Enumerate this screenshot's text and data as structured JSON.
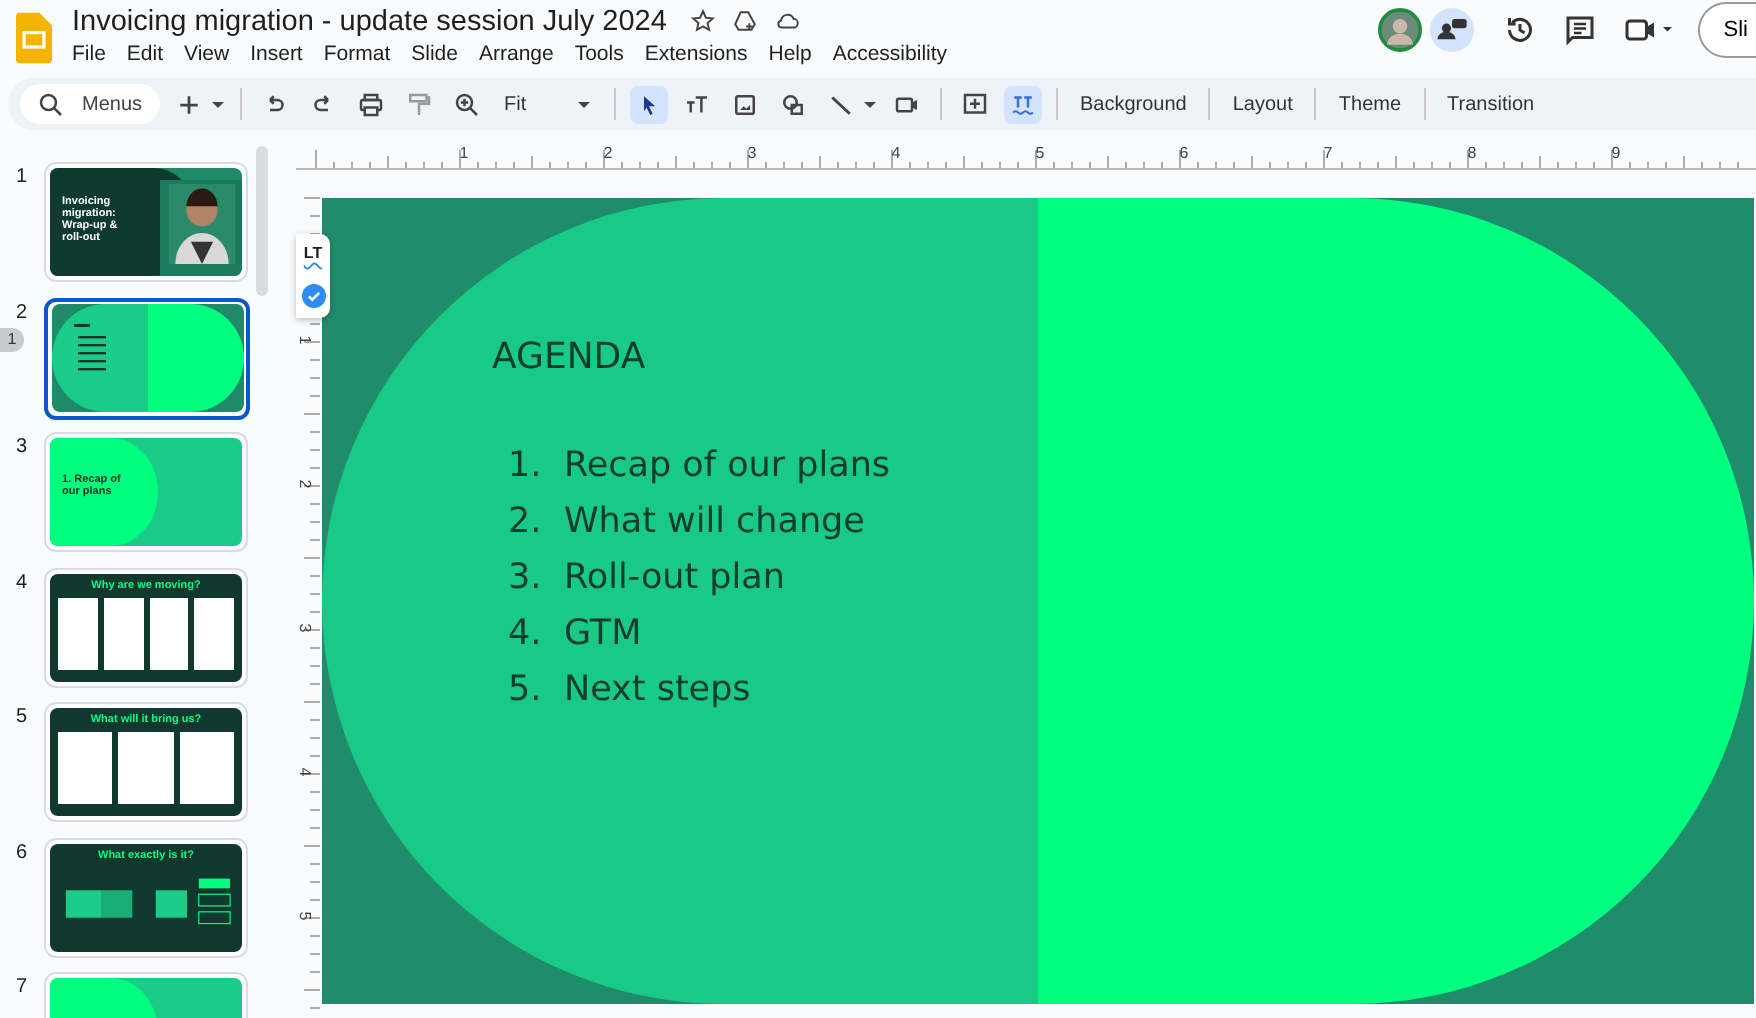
{
  "document": {
    "title": "Invoicing migration - update session July 2024"
  },
  "menu": [
    "File",
    "Edit",
    "View",
    "Insert",
    "Format",
    "Slide",
    "Arrange",
    "Tools",
    "Extensions",
    "Help",
    "Accessibility"
  ],
  "share_button": "Sli",
  "toolbar": {
    "search_placeholder": "Menus",
    "zoom": "Fit",
    "buttons": [
      "Background",
      "Layout",
      "Theme",
      "Transition"
    ]
  },
  "slides": [
    {
      "number": "1",
      "kind": "title",
      "selected": false,
      "title": "Invoicing migration: Wrap-up & roll-out"
    },
    {
      "number": "2",
      "kind": "agenda",
      "selected": true
    },
    {
      "number": "3",
      "kind": "section",
      "selected": false,
      "title": "1. Recap of our plans"
    },
    {
      "number": "4",
      "kind": "quad",
      "selected": false,
      "title": "Why are we moving?"
    },
    {
      "number": "5",
      "kind": "triple",
      "selected": false,
      "title": "What will it bring us?"
    },
    {
      "number": "6",
      "kind": "diagram",
      "selected": false,
      "title": "What exactly is it?"
    },
    {
      "number": "7",
      "kind": "section",
      "selected": false
    }
  ],
  "viewer_badge": "1",
  "ruler": {
    "horizontal": [
      "1",
      "2",
      "3",
      "4",
      "5",
      "6",
      "7",
      "8",
      "9"
    ],
    "vertical": [
      "1",
      "2",
      "3",
      "4",
      "5"
    ]
  },
  "languagetool": {
    "label": "LT"
  },
  "slide": {
    "heading": "AGENDA",
    "items": [
      {
        "number": "1.",
        "text": "Recap of our plans"
      },
      {
        "number": "2.",
        "text": "What will change"
      },
      {
        "number": "3.",
        "text": "Roll-out plan"
      },
      {
        "number": "4.",
        "text": "GTM"
      },
      {
        "number": "5.",
        "text": "Next steps"
      }
    ]
  }
}
